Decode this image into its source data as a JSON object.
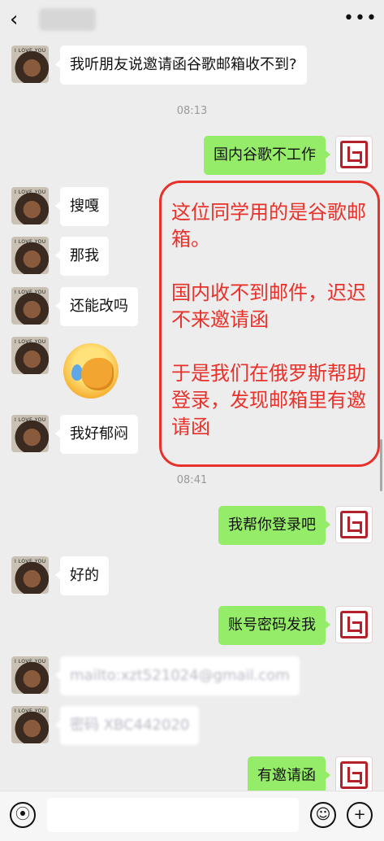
{
  "header": {
    "back_icon": "chevron-left-icon",
    "more_icon": "more-dots-icon"
  },
  "messages": [
    {
      "side": "left",
      "text": "我听朋友说邀请函谷歌邮箱收不到?"
    },
    {
      "side": "time",
      "text": "08:13"
    },
    {
      "side": "right",
      "text": "国内谷歌不工作"
    },
    {
      "side": "left",
      "text": "搜嘎"
    },
    {
      "side": "left",
      "text": "那我"
    },
    {
      "side": "left",
      "text": "还能改吗"
    },
    {
      "side": "left",
      "type": "sticker",
      "icon": "facepalm-crying-emoji-icon"
    },
    {
      "side": "left",
      "text": "我好郁闷"
    },
    {
      "side": "time",
      "text": "08:41"
    },
    {
      "side": "right",
      "text": "我帮你登录吧"
    },
    {
      "side": "left",
      "text": "好的"
    },
    {
      "side": "right",
      "text": "账号密码发我"
    },
    {
      "side": "left",
      "text": "mailto:xzt521024@gmail.com",
      "blurred": true
    },
    {
      "side": "left",
      "text": "密码 XBC442020",
      "blurred": true
    },
    {
      "side": "right",
      "text": "有邀请函"
    }
  ],
  "annotation": {
    "color": "#e8312a",
    "paragraphs": [
      "这位同学用的是谷歌邮箱。",
      "国内收不到邮件，迟迟不来邀请函",
      "于是我们在俄罗斯帮助登录，发现邮箱里有邀请函"
    ]
  },
  "input_bar": {
    "voice_icon": "voice-icon",
    "emoji_icon": "emoji-icon",
    "plus_icon": "plus-icon",
    "placeholder": ""
  },
  "colors": {
    "background": "#ededed",
    "sent_bubble": "#95ec69",
    "received_bubble": "#ffffff"
  }
}
